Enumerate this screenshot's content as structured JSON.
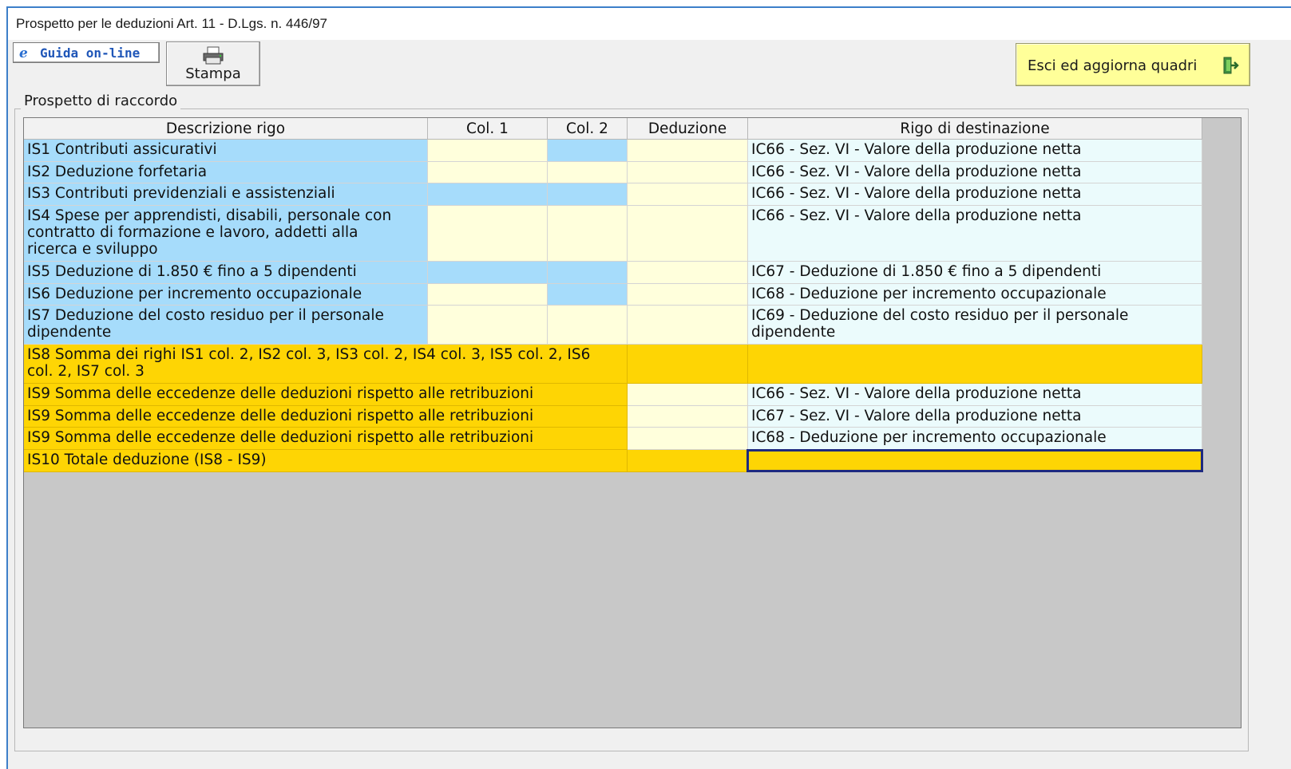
{
  "window": {
    "title": "Prospetto per le deduzioni Art. 11 - D.Lgs. n. 446/97"
  },
  "toolbar": {
    "guida_icon": "e",
    "guida_label": "Guida on-line",
    "stampa_label": "Stampa",
    "esci_label": "Esci ed aggiorna quadri"
  },
  "icons": {
    "guida": "internet-explorer-icon",
    "stampa": "printer-icon",
    "esci": "exit-door-icon"
  },
  "colors": {
    "label_blue": "#a6dcfb",
    "input_cream": "#ffffdc",
    "readonly_pale": "#ebfbfc",
    "total_gold": "#fed504",
    "empty_grid": "#c8c8c8"
  },
  "group": {
    "legend": "Prospetto di raccordo"
  },
  "table": {
    "headers": [
      "Descrizione rigo",
      "Col. 1",
      "Col. 2",
      "Deduzione",
      "Rigo di destinazione"
    ],
    "rows": [
      {
        "desc": "IS1 Contributi assicurativi",
        "col1": "",
        "col2": "",
        "deduzione": "",
        "dest": "IC66 - Sez. VI - Valore della produzione netta"
      },
      {
        "desc": "IS2 Deduzione forfetaria",
        "col1": "",
        "col2": "",
        "deduzione": "",
        "dest": "IC66 - Sez. VI - Valore della produzione netta"
      },
      {
        "desc": "IS3 Contributi previdenziali e assistenziali",
        "col1": "",
        "col2": "",
        "deduzione": "",
        "dest": "IC66 - Sez. VI - Valore della produzione netta"
      },
      {
        "desc": "IS4 Spese per apprendisti, disabili, personale con\ncontratto di formazione e lavoro, addetti alla\nricerca e sviluppo",
        "col1": "",
        "col2": "",
        "deduzione": "",
        "dest": "IC66 - Sez. VI - Valore della produzione netta"
      },
      {
        "desc": "IS5 Deduzione di 1.850 € fino a 5 dipendenti",
        "col1": "",
        "col2": "",
        "deduzione": "",
        "dest": "IC67 - Deduzione di 1.850 € fino a 5 dipendenti"
      },
      {
        "desc": "IS6 Deduzione per incremento occupazionale",
        "col1": "",
        "col2": "",
        "deduzione": "",
        "dest": "IC68 - Deduzione per incremento occupazionale"
      },
      {
        "desc": "IS7 Deduzione del costo residuo per il personale\ndipendente",
        "col1": "",
        "col2": "",
        "deduzione": "",
        "dest": "IC69 - Deduzione del costo residuo per il personale\ndipendente"
      },
      {
        "desc": "IS8 Somma dei righi IS1 col. 2, IS2 col. 3, IS3 col. 2, IS4 col. 3, IS5 col. 2, IS6\ncol. 2, IS7 col. 3",
        "deduzione": "",
        "dest": ""
      },
      {
        "desc": "IS9 Somma delle eccedenze delle deduzioni rispetto alle retribuzioni",
        "deduzione": "",
        "dest": "IC66 - Sez. VI - Valore della produzione netta"
      },
      {
        "desc": "IS9 Somma delle eccedenze delle deduzioni rispetto alle retribuzioni",
        "deduzione": "",
        "dest": "IC67 - Sez. VI - Valore della produzione netta"
      },
      {
        "desc": "IS9 Somma delle eccedenze delle deduzioni rispetto alle retribuzioni",
        "deduzione": "",
        "dest": "IC68 - Deduzione per incremento occupazionale"
      },
      {
        "desc": "IS10 Totale deduzione (IS8 - IS9)",
        "deduzione": "",
        "dest": ""
      }
    ]
  }
}
